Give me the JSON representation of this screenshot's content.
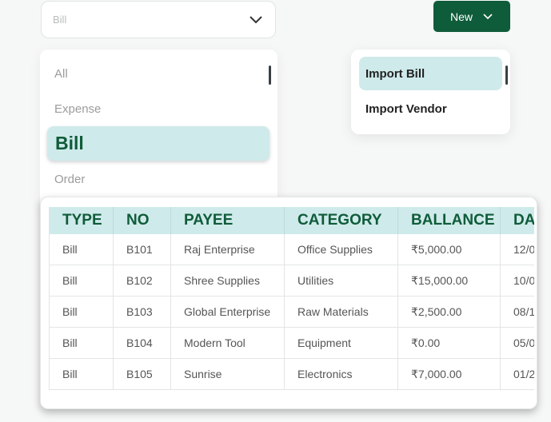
{
  "type_select": {
    "placeholder": "Bill"
  },
  "new_button": {
    "label": "New"
  },
  "type_options": [
    "All",
    "Expense",
    "Bill",
    "Order"
  ],
  "import_menu": {
    "items": [
      "Import Bill",
      "Import Vendor"
    ]
  },
  "table": {
    "columns": [
      "TYPE",
      "NO",
      "PAYEE",
      "CATEGORY",
      "BALLANCE",
      "DATE"
    ],
    "rows": [
      [
        "Bill",
        "B101",
        "Raj Enterprise",
        "Office Supplies",
        "₹5,000.00",
        "12/0"
      ],
      [
        "Bill",
        "B102",
        "Shree Supplies",
        "Utilities",
        "₹15,000.00",
        "10/0"
      ],
      [
        "Bill",
        "B103",
        "Global Enterprise",
        "Raw Materials",
        "₹2,500.00",
        "08/1"
      ],
      [
        "Bill",
        "B104",
        "Modern Tool",
        "Equipment",
        "₹0.00",
        "05/0"
      ],
      [
        "Bill",
        "B105",
        "Sunrise",
        "Electronics",
        "₹7,000.00",
        "01/2"
      ]
    ]
  },
  "colors": {
    "brand_green": "#0f5c3a",
    "highlight": "#cfeaea"
  }
}
